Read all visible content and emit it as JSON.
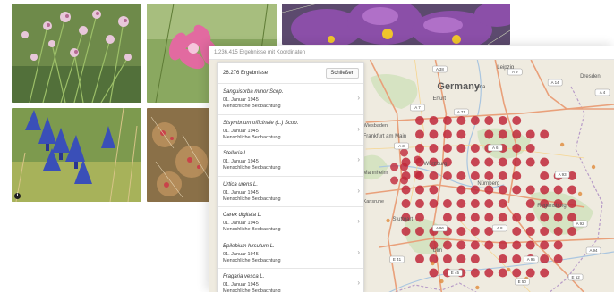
{
  "window": {
    "title": "1.236.415 Ergebnisse mit Koordinaten"
  },
  "panel": {
    "count_label": "26.276 Ergebnisse",
    "close_label": "Schließen",
    "results": [
      {
        "name": "Sanguisorba minor Scop.",
        "date": "01. Januar 1945",
        "type": "Menschliche Beobachtung"
      },
      {
        "name": "Sisymbrium officinale (L.) Scop.",
        "date": "01. Januar 1945",
        "type": "Menschliche Beobachtung"
      },
      {
        "name": "Stellaria L.",
        "date": "01. Januar 1945",
        "type": "Menschliche Beobachtung"
      },
      {
        "name": "Urtica urens L.",
        "date": "01. Januar 1945",
        "type": "Menschliche Beobachtung"
      },
      {
        "name": "Carex digitata L.",
        "date": "01. Januar 1945",
        "type": "Menschliche Beobachtung"
      },
      {
        "name": "Epilobium hirsutum L.",
        "date": "01. Januar 1945",
        "type": "Menschliche Beobachtung"
      },
      {
        "name": "Fragaria vesca L.",
        "date": "01. Januar 1945",
        "type": "Menschliche Beobachtung"
      }
    ]
  },
  "map": {
    "country_label": "Germany",
    "cities": [
      "Leipzig",
      "Dresden",
      "Jena",
      "Frankfurt am Main",
      "Mannheim",
      "Würzburg",
      "Nürnberg",
      "Stuttgart",
      "Ulm",
      "Regensburg",
      "Erfurt",
      "Wiesbaden",
      "Karlsruhe"
    ],
    "city_labels": {
      "leipzig": "Leipzig",
      "dresden": "Dresden",
      "jena": "Jena",
      "frankfurt": "Frankfurt am Main",
      "mannheim": "Mannheim",
      "wurzburg": "Würzburg",
      "nurnberg": "Nürnberg",
      "stuttgart": "Stuttgart",
      "ulm": "Ulm",
      "regensburg": "Regensburg",
      "erfurt": "Erfurt",
      "wiesbaden": "Wiesbaden",
      "karlsruhe": "Karlsruhe"
    },
    "road_labels": [
      "A 38",
      "A 9",
      "A 14",
      "A 4",
      "A 7",
      "A 71",
      "A 3",
      "A 6",
      "A 8",
      "A 96",
      "A 93",
      "A 92",
      "A 94",
      "A 95",
      "E 41",
      "E 45",
      "E 50",
      "E 52"
    ],
    "marker_color": "#c0283a",
    "sparse_marker_color": "#e08a3a"
  },
  "photos": [
    {
      "icon": "allium-flowers-photo"
    },
    {
      "icon": "pink-flower-photo"
    },
    {
      "icon": "pasque-flower-photo"
    },
    {
      "icon": "blue-gentian-photo",
      "badge": "i"
    },
    {
      "icon": "sundew-photo"
    }
  ]
}
